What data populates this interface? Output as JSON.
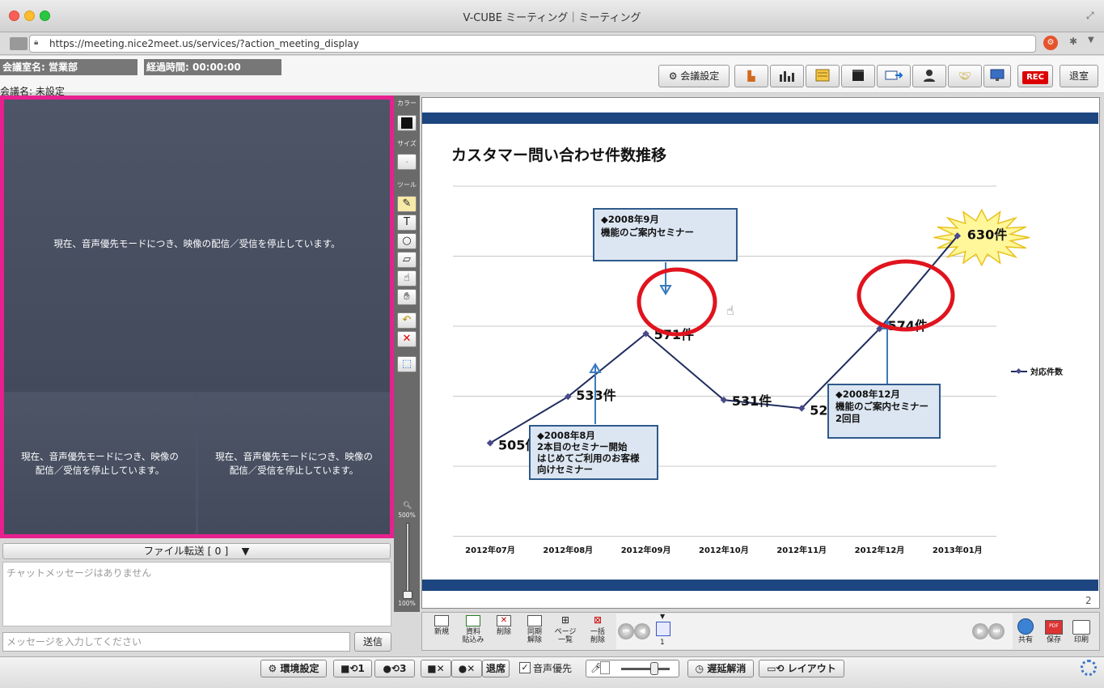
{
  "window": {
    "title": "V-CUBE ミーティング｜ミーティング"
  },
  "browser": {
    "url": "https://meeting.nice2meet.us/services/?action_meeting_display"
  },
  "header": {
    "room_name": "会議室名: 営業部",
    "elapsed": "経過時間: 00:00:00",
    "meeting_name": "会議名: 未設定",
    "settings_label": "会議設定",
    "rec_label": "REC",
    "exit_label": "退室"
  },
  "video": {
    "notice": "現在、音声優先モードにつき、映像の配信／受信を停止しています。",
    "notice_small_a": "現在、音声優先モードにつき、映像の",
    "notice_small_b": "配信／受信を停止しています。"
  },
  "chat": {
    "file_transfer": "ファイル転送 [ 0 ]",
    "empty": "チャットメッセージはありません",
    "placeholder": "メッセージを入力してください",
    "send": "送信"
  },
  "tools": {
    "color": "カラー",
    "size": "サイズ",
    "tool": "ツール",
    "zoom_max": "500%",
    "zoom_min": "100%"
  },
  "document": {
    "title": "カスタマー問い合わせ件数推移",
    "page_number": "2"
  },
  "chart_data": {
    "type": "line",
    "categories": [
      "2012年07月",
      "2012年08月",
      "2012年09月",
      "2012年10月",
      "2012年11月",
      "2012年12月",
      "2013年01月"
    ],
    "series": [
      {
        "name": "対応件数",
        "values": [
          505,
          533,
          571,
          531,
          526,
          574,
          630
        ],
        "color": "#1f2d5e"
      }
    ],
    "data_labels": [
      "505件",
      "533件",
      "571件",
      "531件",
      "526件",
      "574件",
      "630件"
    ],
    "ylim": [
      450,
      660
    ],
    "grid": true,
    "legend": "right",
    "annotations": [
      {
        "lines": [
          "◆2008年9月",
          "機能のご案内セミナー"
        ]
      },
      {
        "lines": [
          "◆2008年8月",
          "2本目のセミナー開始",
          "はじめてご利用のお客様",
          "向けセミナー"
        ]
      },
      {
        "lines": [
          "◆2008年12月",
          "機能のご案内セミナー",
          "2回目"
        ]
      }
    ]
  },
  "docnav": {
    "new": "新規",
    "paste_1": "資料",
    "paste_2": "貼込み",
    "delete": "削除",
    "unsync_1": "同期",
    "unsync_2": "解除",
    "pages_1": "ページ",
    "pages_2": "一覧",
    "bulk_1": "一括",
    "bulk_2": "削除",
    "current_page": "1",
    "share": "共有",
    "save": "保存",
    "print": "印刷",
    "pdf": "PDF"
  },
  "bottombar": {
    "env_settings": "環境設定",
    "cam_count": "1",
    "rotate_count": "3",
    "leave_seat": "退席",
    "audio_priority": "音声優先",
    "delay_cancel": "遅延解消",
    "layout": "レイアウト"
  }
}
